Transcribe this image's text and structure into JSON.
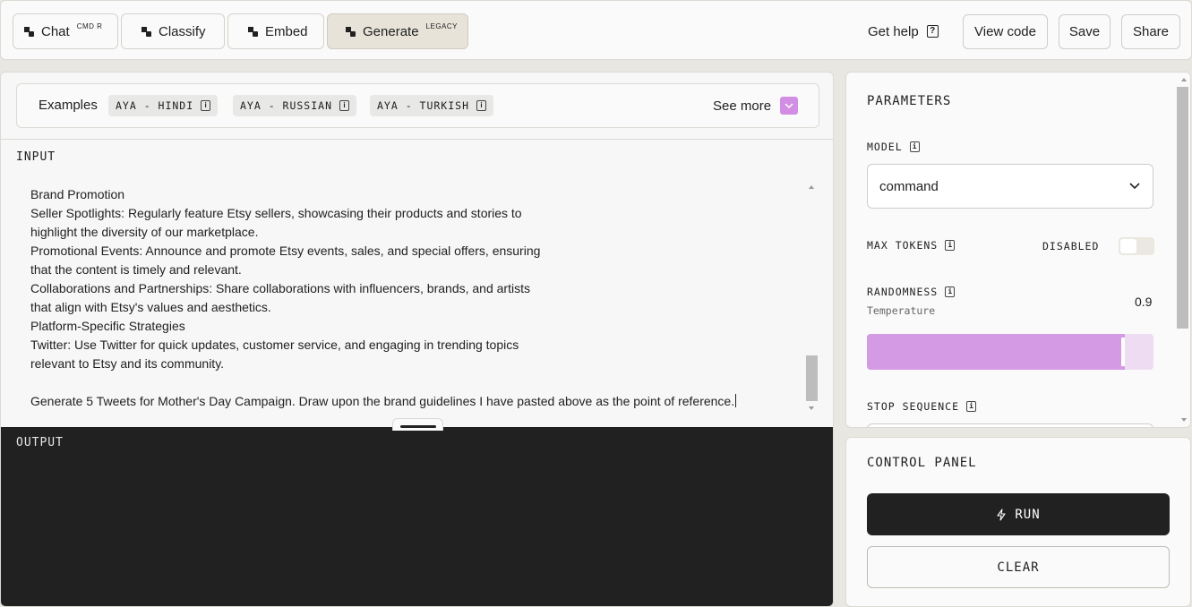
{
  "topbar": {
    "tabs": [
      {
        "label": "Chat",
        "tag": "CMD R",
        "active": false
      },
      {
        "label": "Classify",
        "tag": "",
        "active": false
      },
      {
        "label": "Embed",
        "tag": "",
        "active": false
      },
      {
        "label": "Generate",
        "tag": "LEGACY",
        "active": true
      }
    ],
    "get_help": "Get help",
    "help_icon": "?",
    "view_code": "View code",
    "save": "Save",
    "share": "Share"
  },
  "examples": {
    "label": "Examples",
    "chips": [
      "AYA - HINDI",
      "AYA - RUSSIAN",
      "AYA - TURKISH"
    ],
    "see_more": "See more"
  },
  "input": {
    "label": "INPUT",
    "lines": [
      "Brand Promotion",
      "Seller Spotlights: Regularly feature Etsy sellers, showcasing their products and stories to",
      "highlight the diversity of our marketplace.",
      "Promotional Events: Announce and promote Etsy events, sales, and special offers, ensuring",
      "that the content is timely and relevant.",
      "Collaborations and Partnerships: Share collaborations with influencers, brands, and artists",
      "that align with Etsy's values and aesthetics.",
      "Platform-Specific Strategies",
      "Twitter: Use Twitter for quick updates, customer service, and engaging in trending topics",
      "relevant to Etsy and its community.",
      "",
      "Generate 5 Tweets for Mother's Day Campaign. Draw upon the brand guidelines I have pasted above as the point of reference."
    ]
  },
  "output": {
    "label": "OUTPUT"
  },
  "parameters": {
    "title": "PARAMETERS",
    "model_label": "MODEL",
    "model_value": "command",
    "max_tokens_label": "MAX TOKENS",
    "max_tokens_state": "DISABLED",
    "randomness_label": "RANDOMNESS",
    "temperature_label": "Temperature",
    "temperature_value": "0.9",
    "temperature_fraction": 0.9,
    "stop_sequence_label": "STOP SEQUENCE",
    "info_icon": "i"
  },
  "control_panel": {
    "title": "CONTROL PANEL",
    "run": "RUN",
    "clear": "CLEAR"
  },
  "colors": {
    "accent": "#d49ae4",
    "dark": "#212121",
    "background": "#e9e7e1"
  }
}
